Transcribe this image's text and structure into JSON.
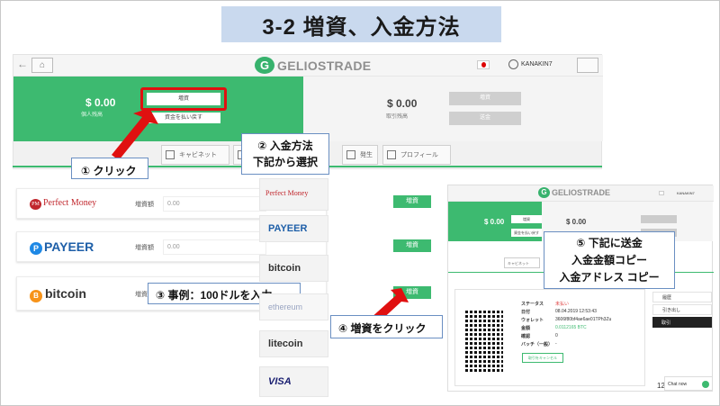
{
  "slide": {
    "title": "3-2 増資、入金方法",
    "page_number": "12"
  },
  "app": {
    "logo_mark": "G",
    "logo_text": "GELIOSTRADE",
    "username": "KANAKIN7",
    "left_balance": {
      "amount": "$ 0.00",
      "label": "個人残高"
    },
    "right_balance": {
      "amount": "$ 0.00",
      "label": "取引残高"
    },
    "deposit_btn": "増資",
    "withdraw_btn": "資金を払い戻す",
    "right_btn1": "増資",
    "right_btn2": "送金",
    "tabs": [
      "キャビネット",
      "",
      "",
      "発生",
      "プロフィール"
    ]
  },
  "callouts": {
    "c1": "① クリック",
    "c2_line1": "② 入金方法",
    "c2_line2": "下記から選択",
    "c3": "③ 事例：100ドルを入力",
    "c4": "④ 増資をクリック",
    "c5_line1": "⑤ 下記に送金",
    "c5_line2": "入金金額コピー",
    "c5_line3": "入金アドレス コピー"
  },
  "payment_rows": [
    {
      "name": "Perfect Money",
      "mark": "PM",
      "label": "増資額",
      "value": "0.00",
      "button": "増資"
    },
    {
      "name": "PAYEER",
      "mark": "P",
      "label": "増資額",
      "value": "0.00",
      "button": "増資"
    },
    {
      "name": "bitcoin",
      "mark": "B",
      "label": "増資額",
      "value": "",
      "button": "増資"
    }
  ],
  "methods": [
    "Perfect Money",
    "PAYEER",
    "bitcoin",
    "ethereum",
    "litecoin",
    "VISA"
  ],
  "screenshot2": {
    "logo_text": "GELIOSTRADE",
    "username": "KANAKIN7",
    "left_amount": "$ 0.00",
    "right_amount": "$ 0.00",
    "btn1": "増資",
    "btn2": "資金を払い戻す",
    "tab": "キャビネット",
    "details": [
      {
        "k": "ステータス",
        "v": "未払い"
      },
      {
        "k": "日付",
        "v": "08.04.2019 12:53:43"
      },
      {
        "k": "ウォレット",
        "v": "3606f80bf4ae6ae01TPh3Zu"
      },
      {
        "k": "金額",
        "v": "0.0112165 BTC"
      },
      {
        "k": "確認",
        "v": "0"
      },
      {
        "k": "バッチ（一般）",
        "v": "-"
      }
    ],
    "cancel_btn": "取引をキャンセル",
    "side_items": [
      "履歴",
      "引き出し",
      "取引"
    ],
    "chat_label": "Chat now"
  }
}
